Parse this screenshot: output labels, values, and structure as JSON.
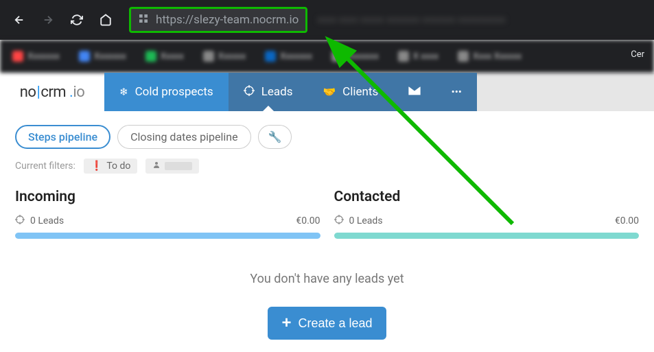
{
  "browser": {
    "url": "https://slezy-team.nocrm.io",
    "bookmark_visible": "Cer"
  },
  "logo": {
    "no": "no",
    "crm": "crm",
    "io": "io"
  },
  "nav": {
    "cold_prospects": "Cold prospects",
    "leads": "Leads",
    "clients": "Clients"
  },
  "pills": {
    "steps": "Steps pipeline",
    "closing": "Closing dates pipeline"
  },
  "filters": {
    "label": "Current filters:",
    "todo": "To do"
  },
  "columns": {
    "incoming": {
      "title": "Incoming",
      "leads": "0 Leads",
      "amount": "€0.00"
    },
    "contacted": {
      "title": "Contacted",
      "leads": "0 Leads",
      "amount": "€0.00"
    }
  },
  "empty": {
    "message": "You don't have any leads yet",
    "button": "Create a lead"
  }
}
